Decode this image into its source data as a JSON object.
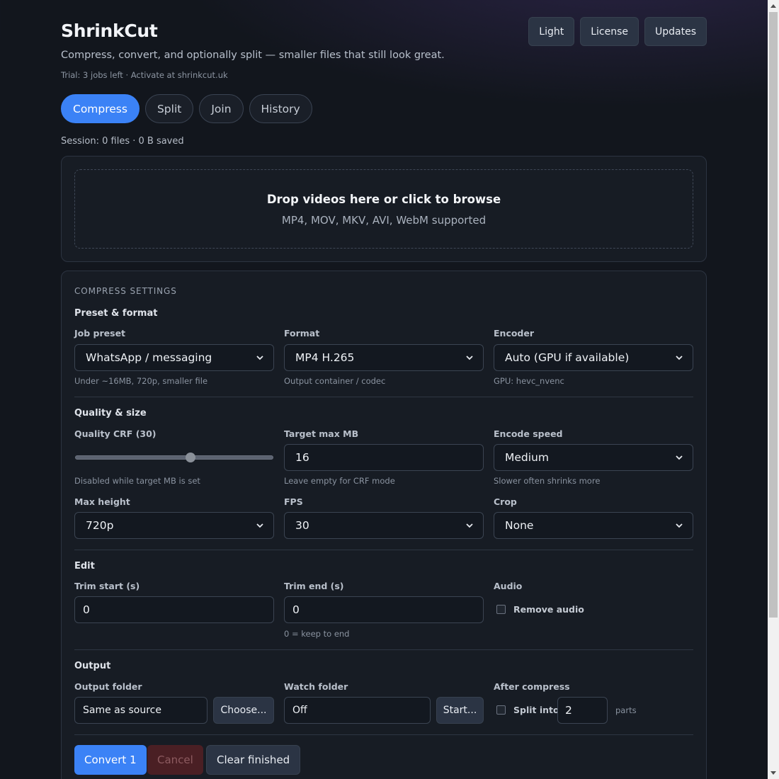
{
  "app": {
    "title": "ShrinkCut",
    "subtitle": "Compress, convert, and optionally split — smaller files that still look great.",
    "trial": "Trial: 3 jobs left · Activate at shrinkcut.uk"
  },
  "header": {
    "buttons": [
      "Light",
      "License",
      "Updates"
    ]
  },
  "tabs": [
    {
      "label": "Compress",
      "active": true
    },
    {
      "label": "Split",
      "active": false
    },
    {
      "label": "Join",
      "active": false
    },
    {
      "label": "History",
      "active": false
    }
  ],
  "session": "Session: 0 files · 0 B saved",
  "dropzone": {
    "title": "Drop videos here or click to browse",
    "subtitle": "MP4, MOV, MKV, AVI, WebM supported"
  },
  "settings": {
    "section_label": "COMPRESS SETTINGS",
    "preset_group": {
      "title": "Preset & format",
      "job_preset": {
        "label": "Job preset",
        "value": "WhatsApp / messaging",
        "hint": "Under ~16MB, 720p, smaller file"
      },
      "format": {
        "label": "Format",
        "value": "MP4 H.265",
        "hint": "Output container / codec"
      },
      "encoder": {
        "label": "Encoder",
        "value": "Auto (GPU if available)",
        "hint": "GPU: hevc_nvenc"
      }
    },
    "quality_group": {
      "title": "Quality & size",
      "crf": {
        "label": "Quality CRF (30)",
        "value": 30,
        "min": 0,
        "max": 51,
        "hint": "Disabled while target MB is set"
      },
      "target_mb": {
        "label": "Target max MB",
        "value": "16",
        "hint": "Leave empty for CRF mode"
      },
      "encode_speed": {
        "label": "Encode speed",
        "value": "Medium",
        "hint": "Slower often shrinks more"
      },
      "max_height": {
        "label": "Max height",
        "value": "720p"
      },
      "fps": {
        "label": "FPS",
        "value": "30"
      },
      "crop": {
        "label": "Crop",
        "value": "None"
      }
    },
    "edit_group": {
      "title": "Edit",
      "trim_start": {
        "label": "Trim start (s)",
        "value": "0"
      },
      "trim_end": {
        "label": "Trim end (s)",
        "value": "0",
        "hint": "0 = keep to end"
      },
      "audio": {
        "label": "Audio",
        "checkbox_label": "Remove audio",
        "checked": false
      }
    },
    "output_group": {
      "title": "Output",
      "output_folder": {
        "label": "Output folder",
        "value": "Same as source",
        "button": "Choose..."
      },
      "watch_folder": {
        "label": "Watch folder",
        "value": "Off",
        "button": "Start..."
      },
      "after_compress": {
        "label": "After compress",
        "checkbox_label": "Split into",
        "checked": false,
        "parts_value": "2",
        "parts_suffix": "parts"
      }
    },
    "actions": {
      "convert": "Convert 1",
      "cancel": "Cancel",
      "clear": "Clear finished"
    }
  }
}
